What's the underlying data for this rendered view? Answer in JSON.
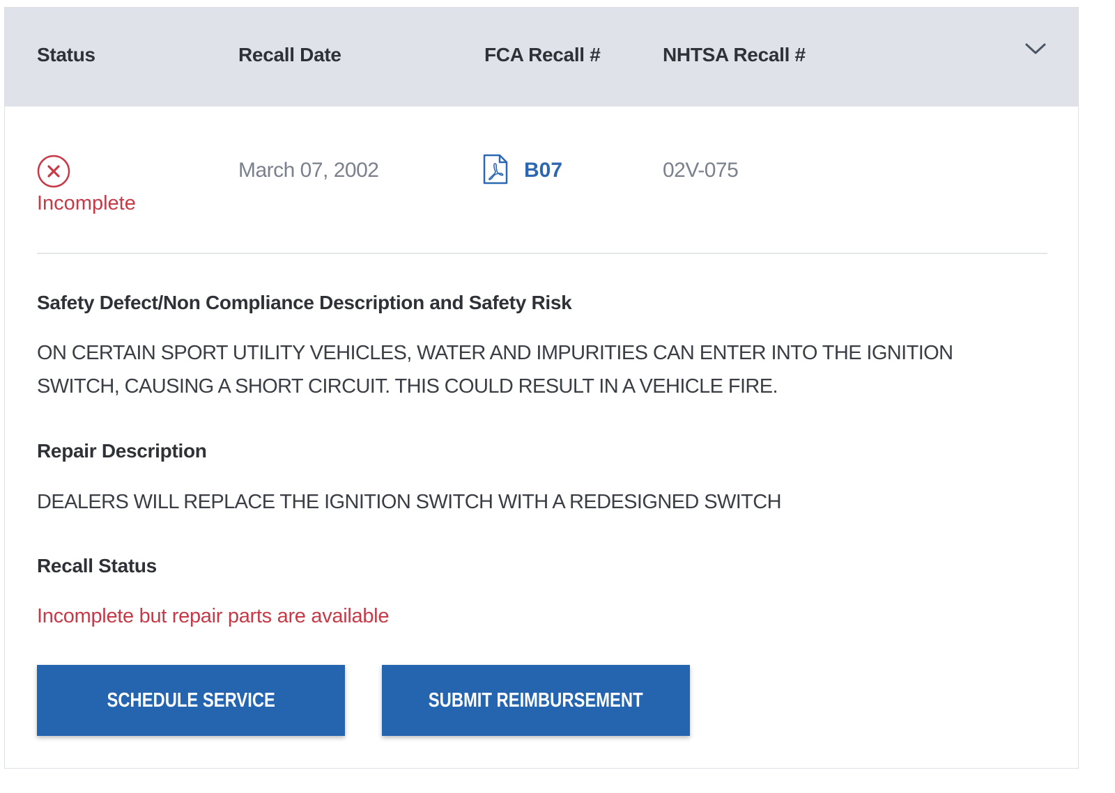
{
  "header": {
    "columns": {
      "status": "Status",
      "recall_date": "Recall Date",
      "fca_recall": "FCA Recall #",
      "nhtsa_recall": "NHTSA Recall #"
    },
    "toggle_icon": "chevron-down-icon"
  },
  "recall": {
    "status_icon": "x-circle-icon",
    "status": "Incomplete",
    "date": "March 07, 2002",
    "fca_icon": "pdf-icon",
    "fca_number": "B07",
    "nhtsa_number": "02V-075"
  },
  "details": {
    "defect_title": "Safety Defect/Non Compliance Description and Safety Risk",
    "defect_body": "ON CERTAIN SPORT UTILITY VEHICLES, WATER AND IMPURITIES CAN ENTER INTO THE IGNITION SWITCH, CAUSING A SHORT CIRCUIT. THIS COULD RESULT IN A VEHICLE FIRE.",
    "repair_title": "Repair Description",
    "repair_body": "DEALERS WILL REPLACE THE IGNITION SWITCH WITH A REDESIGNED SWITCH",
    "status_title": "Recall Status",
    "status_body": "Incomplete but repair parts are available"
  },
  "actions": {
    "schedule_label": "SCHEDULE SERVICE",
    "reimburse_label": "SUBMIT REIMBURSEMENT"
  },
  "colors": {
    "header_bg": "#dfe2e8",
    "incomplete_red": "#c63a48",
    "link_blue": "#2c68b0",
    "button_blue": "#2565b0"
  }
}
